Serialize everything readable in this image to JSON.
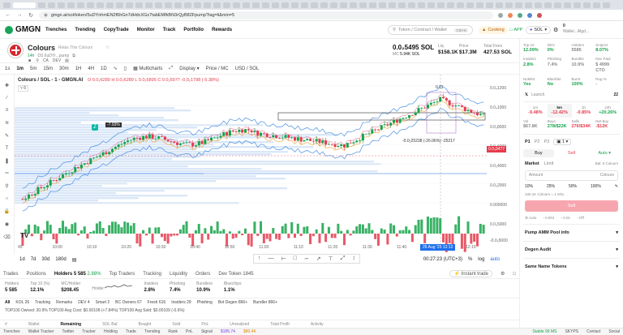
{
  "browser": {
    "url": "gmgn.ai/sol/token/5uDYnhmEN2f6hGn7dHdcXGz7tabEMfkBN3rQyB82Fpump?tag=li&min=5",
    "lock_icon": "site-info-icon"
  },
  "app": {
    "logo": "GMGN",
    "nav": [
      "Trenches",
      "Trending",
      "CopyTrade",
      "Monitor",
      "Track",
      "Portfolio",
      "Rewards"
    ],
    "search_placeholder": "Token / Contract / Wallet",
    "search_kbd": "Ctrl+K",
    "cooking": "Cooking",
    "app_btn": "APP",
    "chain": "SOL",
    "wallet_balance": "0",
    "wallet_name": "Wallet...Algd..."
  },
  "token": {
    "name": "Colours",
    "subtitle": "Relax This Colours",
    "age": "14h",
    "contract": "DS 6uDYr...pump",
    "price": "0.0₂5495 SOL",
    "mc_label": "MC",
    "mc_value": "5.94K SOL",
    "liq_label": "Liq",
    "liq_value": "$158.1K",
    "price_usd_label": "Price",
    "price_usd": "$17.3M",
    "total_fees_label": "Total Fees",
    "total_fees": "427.53 SOL"
  },
  "chart_toolbar": {
    "timeframes": [
      "1s",
      "1m",
      "5m",
      "15m",
      "30m",
      "1H",
      "4H",
      "1D"
    ],
    "selected": "1m",
    "multicharts": "Multicharts",
    "display": "Display",
    "price_mc": "Price / MC",
    "currency": "USD / SOL"
  },
  "chart_data": {
    "type": "candlestick",
    "title": "Colours / SOL - 1 - GMGN.AI",
    "ohlc": "O 0.0₂6289 H 0.0₂6289 L 0.0₂5895 C 0.0₂5977 -0.0₂1798 (-5.38%)",
    "x_ticks": [
      "45",
      "10:00",
      "10:10",
      "10:20",
      "10:30",
      "10:40",
      "10:50",
      "11:00",
      "11:10",
      "11:20",
      "11:30",
      "11:40",
      "12:00",
      "12:10"
    ],
    "crosshair_date": "26 Aug '25",
    "crosshair_time": "12:12",
    "y_ticks": [
      "0.0₄1200",
      "0.0₄1000",
      "0.0₃8000",
      "0.0₃6000",
      "0.0₃4000",
      "0.0₃2000",
      "0.000000"
    ],
    "volume_ticks": [
      "0.0₃5000",
      "-0.0₃5000"
    ],
    "last_price_label": "0.0₃9477",
    "annotation_left": "-7.93%",
    "annotation_top": "0.11",
    "annotation_range": "-0.0₂25238 (-26.06%) -25217",
    "time_display": "00:27:23 (UTC+3)",
    "log_label": "log",
    "auto_label": "auto"
  },
  "bottom_timeframes": [
    "1d",
    "7d",
    "30d",
    "180d"
  ],
  "bottom_tabs": [
    "Trades",
    "Positions",
    "Holders 5 585",
    "Top Traders",
    "Tracking",
    "Liquidity",
    "Orders",
    "Dev Token 1845"
  ],
  "holders_pct": "2.88%",
  "instant_trade": "Instant trade",
  "holders_stats": [
    {
      "label": "Holders",
      "value": "5 585"
    },
    {
      "label": "Top 10 (%)",
      "value": "12.1%"
    },
    {
      "label": "MC/Holder",
      "value": "$208.45"
    },
    {
      "label": "Holder",
      "value": ""
    },
    {
      "label": "Insiders",
      "value": "2.8%"
    },
    {
      "label": "Phishing",
      "value": "7.4%"
    },
    {
      "label": "Bundlers",
      "value": "10.9%"
    },
    {
      "label": "Bluechips",
      "value": "1.1%"
    }
  ],
  "filter_tabs": [
    "All",
    "KOL 26",
    "Tracking",
    "Remarks",
    "DEV 4",
    "Smart 2",
    "BC Owners 67",
    "Fresh 616",
    "Insiders 29",
    "Phishing",
    "Bot Degen 866+",
    "Bundler 866+"
  ],
  "top_info": "TOP100 Owned: 30.9%  TOP100 Avg Cost: $0.00108 (+7.84%)  TOP100 Avg Sold: $0.00109 (-0.6%)",
  "table_headers": [
    "#",
    "Wallet",
    "Remaining",
    "SOL Bal",
    "Bought",
    "Sold",
    "PnL",
    "Unrealized",
    "Total Profit",
    "Activity"
  ],
  "footer": [
    "Trenches",
    "Wallet Tracker",
    "Twitter",
    "Tracker",
    "Holding",
    "Trade",
    "Trending",
    "Rank",
    "PnL",
    "Signal",
    "$185.74",
    "$80.4K",
    "Stable 99 MS",
    "SKYPS",
    "Contact",
    "Social"
  ],
  "right_panel": {
    "stats_row1": [
      {
        "label": "Top 10",
        "value": "12.09%",
        "cls": "green"
      },
      {
        "label": "DEV",
        "value": "0%",
        "cls": "green"
      },
      {
        "label": "Holders",
        "value": "5585",
        "cls": ""
      },
      {
        "label": "Snipers",
        "value": "8.07%",
        "cls": "green"
      }
    ],
    "stats_row2": [
      {
        "label": "Insiders",
        "value": "2.8%",
        "cls": "green"
      },
      {
        "label": "Phishing",
        "value": "7.4%",
        "cls": ""
      },
      {
        "label": "Bundler",
        "value": "10.9%",
        "cls": ""
      },
      {
        "label": "Dex Paid",
        "value": "$ 4999 CTO",
        "cls": ""
      }
    ],
    "stats_row3": [
      {
        "label": "NoMint",
        "value": "Yes",
        "cls": "green"
      },
      {
        "label": "Blacklist",
        "value": "No",
        "cls": "green"
      },
      {
        "label": "Burnt",
        "value": "100%",
        "cls": "green"
      },
      {
        "label": "Rug %",
        "value": "-",
        "cls": ""
      }
    ],
    "launch_label": "Launch",
    "launch_value": "22",
    "periods": [
      {
        "label": "1m",
        "value": "-9.48%",
        "cls": "red"
      },
      {
        "label": "5m",
        "value": "-12.42%",
        "cls": "red"
      },
      {
        "label": "1h",
        "value": "-0.85%",
        "cls": "red"
      },
      {
        "label": "24h",
        "value": "+20.26%",
        "cls": "green"
      }
    ],
    "vol_row": [
      {
        "label": "Vol",
        "value": "$67.8K",
        "cls": ""
      },
      {
        "label": "Buys",
        "value": "278/$22K",
        "cls": "green"
      },
      {
        "label": "Sells",
        "value": "276/$34K",
        "cls": "red"
      },
      {
        "label": "Net Buy",
        "value": "-$12K",
        "cls": "red"
      }
    ],
    "presets": [
      "P1",
      "P2",
      "P3"
    ],
    "preset_extra": "1",
    "buy": "Buy",
    "sell": "Sell",
    "auto": "Auto",
    "order_types": [
      "Market",
      "Limit"
    ],
    "balance": "Bal: 0 Colours",
    "amount_label": "Amount",
    "amount_unit": "Colours",
    "pct_options": [
      "10%",
      "25%",
      "50%",
      "100%"
    ],
    "calc_text": "100.1K Colours = 1 SOL",
    "sell_button": "Sell",
    "options": [
      "Auto",
      "0.001",
      "0.01",
      "Off"
    ],
    "sections": [
      "Pump AMM Pool info",
      "Degen Audit",
      "Same Name Tokens"
    ]
  }
}
